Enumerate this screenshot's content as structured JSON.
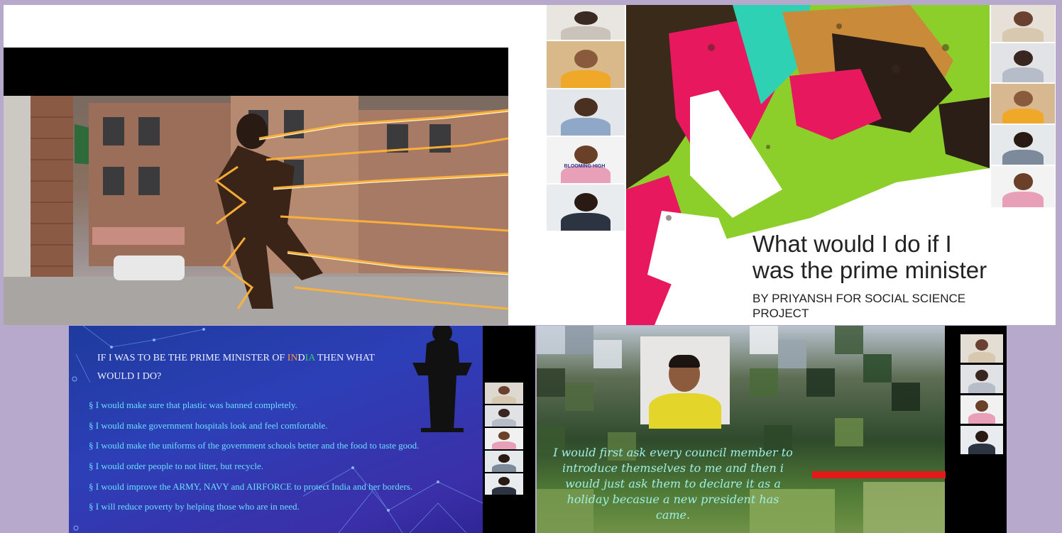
{
  "slide_top": {
    "title_line1": "What would I do if I",
    "title_line2": "was the prime minister",
    "subtitle": "BY PRIYANSH FOR SOCIAL SCIENCE PROJECT",
    "tile_logo_text": "BLOOMING HIGH"
  },
  "slide_list": {
    "heading_part1": "IF I WAS TO BE THE PRIME MINISTER OF ",
    "heading_country": "INDIA",
    "heading_part2": " THEN WHAT WOULD I DO?",
    "items": [
      "§ I would make sure that plastic was banned completely.",
      "§ I would make government hospitals look and feel comfortable.",
      "§ I would make the uniforms of the government schools better and the food to taste good.",
      "§ I would order people to not litter, but recycle.",
      "§ I would improve the ARMY, NAVY and AIRFORCE to protect India and her borders.",
      "§ I will reduce poverty by helping those who are in need."
    ]
  },
  "presentation_caption": "I would first ask every council member to introduce themselves to me and then i would just ask them to declare it as a holiday becasue a new president has came.",
  "colors": {
    "background": "#b7a9cc",
    "slide_blue": "#2d3fb7",
    "list_text": "#6bdfff",
    "caption_text": "#9fefe6",
    "india_colors": [
      "#ff9933",
      "#ffffff",
      "#138808"
    ]
  }
}
